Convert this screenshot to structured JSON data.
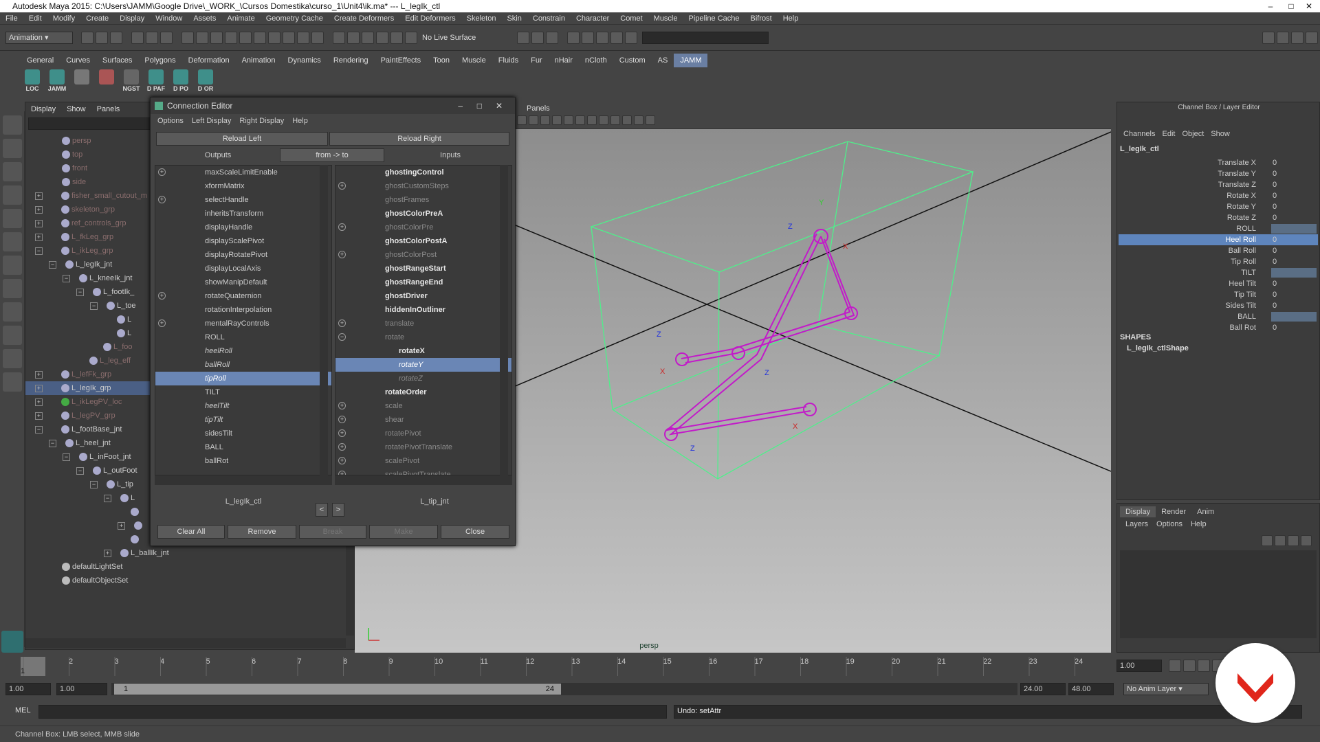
{
  "window": {
    "title": "Autodesk Maya 2015: C:\\Users\\JAMM\\Google Drive\\_WORK_\\Cursos Domestika\\curso_1\\Unit4\\ik.ma*  ---  L_legIk_ctl"
  },
  "menubar": [
    "File",
    "Edit",
    "Modify",
    "Create",
    "Display",
    "Window",
    "Assets",
    "Animate",
    "Geometry Cache",
    "Create Deformers",
    "Edit Deformers",
    "Skeleton",
    "Skin",
    "Constrain",
    "Character",
    "Comet",
    "Muscle",
    "Pipeline Cache",
    "Bifrost",
    "Help"
  ],
  "statusline": {
    "mode": "Animation",
    "live_surface": "No Live Surface"
  },
  "shelf_tabs": [
    "General",
    "Curves",
    "Surfaces",
    "Polygons",
    "Deformation",
    "Animation",
    "Dynamics",
    "Rendering",
    "PaintEffects",
    "Toon",
    "Muscle",
    "Fluids",
    "Fur",
    "nHair",
    "nCloth",
    "Custom",
    "AS",
    "JAMM"
  ],
  "shelf_buttons": [
    "LOC",
    "JAMM",
    "",
    "",
    "NGST",
    "D PAF",
    "D PO",
    "D OR"
  ],
  "outliner": {
    "menu": [
      "Display",
      "Show",
      "Panels"
    ],
    "items": [
      "persp",
      "top",
      "front",
      "side",
      "fisher_small_cutout_m",
      "skeleton_grp",
      "ref_controls_grp",
      "L_fkLeg_grp",
      "L_ikLeg_grp",
      "L_legIk_jnt",
      "L_kneeIk_jnt",
      "L_footIk_",
      "L_toe",
      "L",
      "L",
      "L_foo",
      "L_leg_eff",
      "L_lefFk_grp",
      "L_legIk_grp",
      "L_ikLegPV_loc",
      "L_legPV_grp",
      "L_footBase_jnt",
      "L_heel_jnt",
      "L_inFoot_jnt",
      "L_outFoot",
      "L_tip",
      "L",
      "",
      "",
      "L_ballIk_jnt",
      "defaultLightSet",
      "defaultObjectSet"
    ]
  },
  "connection_editor": {
    "title": "Connection Editor",
    "menu": [
      "Options",
      "Left Display",
      "Right Display",
      "Help"
    ],
    "reload_left": "Reload Left",
    "reload_right": "Reload Right",
    "outputs": "Outputs",
    "direction": "from -> to",
    "inputs": "Inputs",
    "left_items": [
      "maxScaleLimitEnable",
      "xformMatrix",
      "selectHandle",
      "inheritsTransform",
      "displayHandle",
      "displayScalePivot",
      "displayRotatePivot",
      "displayLocalAxis",
      "showManipDefault",
      "rotateQuaternion",
      "rotationInterpolation",
      "mentalRayControls",
      "ROLL",
      "heelRoll",
      "ballRoll",
      "tipRoll",
      "TILT",
      "heelTilt",
      "tipTilt",
      "sidesTilt",
      "BALL",
      "ballRot"
    ],
    "right_items": [
      "ghostingControl",
      "ghostCustomSteps",
      "ghostFrames",
      "ghostColorPreA",
      "ghostColorPre",
      "ghostColorPostA",
      "ghostColorPost",
      "ghostRangeStart",
      "ghostRangeEnd",
      "ghostDriver",
      "hiddenInOutliner",
      "translate",
      "rotate",
      "rotateX",
      "rotateY",
      "rotateZ",
      "rotateOrder",
      "scale",
      "shear",
      "rotatePivot",
      "rotatePivotTranslate",
      "scalePivot",
      "scalePivotTranslate"
    ],
    "left_node": "L_legIk_ctl",
    "right_node": "L_tip_jnt",
    "nav_prev": "<",
    "nav_next": ">",
    "buttons": {
      "clear_all": "Clear All",
      "remove": "Remove",
      "break": "Break",
      "make": "Make",
      "close": "Close"
    }
  },
  "viewport": {
    "panels_menu": "Panels",
    "camera": "persp"
  },
  "channel_box": {
    "header": "Channel Box / Layer Editor",
    "menu": [
      "Channels",
      "Edit",
      "Object",
      "Show"
    ],
    "node": "L_legIk_ctl",
    "channels": [
      {
        "name": "Translate X",
        "value": "0"
      },
      {
        "name": "Translate Y",
        "value": "0"
      },
      {
        "name": "Translate Z",
        "value": "0"
      },
      {
        "name": "Rotate X",
        "value": "0"
      },
      {
        "name": "Rotate Y",
        "value": "0"
      },
      {
        "name": "Rotate Z",
        "value": "0"
      },
      {
        "name": "ROLL",
        "value": ""
      },
      {
        "name": "Heel Roll",
        "value": "0"
      },
      {
        "name": "Ball Roll",
        "value": "0"
      },
      {
        "name": "Tip Roll",
        "value": "0"
      },
      {
        "name": "TILT",
        "value": ""
      },
      {
        "name": "Heel Tilt",
        "value": "0"
      },
      {
        "name": "Tip Tilt",
        "value": "0"
      },
      {
        "name": "Sides Tilt",
        "value": "0"
      },
      {
        "name": "BALL",
        "value": ""
      },
      {
        "name": "Ball Rot",
        "value": "0"
      }
    ],
    "shapes_label": "SHAPES",
    "shape_node": "L_legIk_ctlShape"
  },
  "layer_editor": {
    "tabs": [
      "Display",
      "Render",
      "Anim"
    ],
    "menu": [
      "Layers",
      "Options",
      "Help"
    ]
  },
  "time_slider": {
    "ticks": [
      "1",
      "2",
      "3",
      "4",
      "5",
      "6",
      "7",
      "8",
      "9",
      "10",
      "11",
      "12",
      "13",
      "14",
      "15",
      "16",
      "17",
      "18",
      "19",
      "20",
      "21",
      "22",
      "23",
      "24"
    ],
    "current_frame": "1.00",
    "current_tick": "1"
  },
  "range_slider": {
    "start": "1.00",
    "inner_start": "1.00",
    "range_label_start": "1",
    "range_label_end": "24",
    "end": "24.00",
    "outer_end": "48.00",
    "anim_layer": "No Anim Layer"
  },
  "command_line": {
    "mel_label": "MEL",
    "result": "Undo: setAttr"
  },
  "help_line": "Channel Box: LMB select, MMB slide",
  "colors": {
    "selection": "#6a86b5",
    "accent": "#e0261b",
    "wire_green": "#4ef08a",
    "joint_magenta": "#c21ac9"
  }
}
